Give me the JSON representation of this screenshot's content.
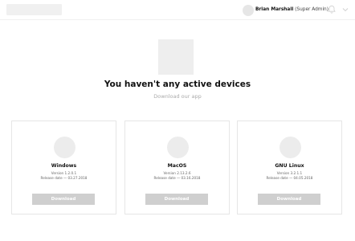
{
  "header": {
    "user_name": "Brian Marshall",
    "user_role": "(Super Admin)",
    "icons": [
      "bell-icon",
      "chevron-down-icon"
    ]
  },
  "main": {
    "title": "You haven't any active devices",
    "subtitle": "Download our app"
  },
  "devices": [
    {
      "name": "Windows",
      "version": "Version 1.2.0.1",
      "release": "Release date — 03.27.2018",
      "button": "Download"
    },
    {
      "name": "MacOS",
      "version": "Version 2.13.2.6",
      "release": "Release date — 03.16.2018",
      "button": "Download"
    },
    {
      "name": "GNU Linux",
      "version": "Version 3.2.1.1",
      "release": "Release date — 04.05.2018",
      "button": "Download"
    }
  ],
  "colors": {
    "button_bg": "#cfcfcf",
    "placeholder": "#eeeeee"
  }
}
